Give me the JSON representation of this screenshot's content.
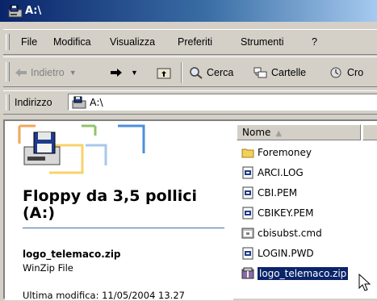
{
  "window": {
    "title": "A:\\"
  },
  "menubar": {
    "items": [
      {
        "label": "File"
      },
      {
        "label": "Modifica"
      },
      {
        "label": "Visualizza"
      },
      {
        "label": "Preferiti"
      },
      {
        "label": "Strumenti"
      },
      {
        "label": "?"
      }
    ]
  },
  "toolbar": {
    "back_label": "Indietro",
    "search_label": "Cerca",
    "folders_label": "Cartelle",
    "history_label": "Cro"
  },
  "address": {
    "label": "Indirizzo",
    "value": "A:\\"
  },
  "left_panel": {
    "drive_title": "Floppy da 3,5 pollici (A:)",
    "selected_file_name": "logo_telemaco.zip",
    "selected_file_type": "WinZip File",
    "selected_file_modified": "Ultima modifica: 11/05/2004 13.27"
  },
  "file_list": {
    "column_name": "Nome",
    "items": [
      {
        "name": "Foremoney",
        "icon": "folder-icon"
      },
      {
        "name": "ARCI.LOG",
        "icon": "text-file-icon"
      },
      {
        "name": "CBI.PEM",
        "icon": "text-file-icon"
      },
      {
        "name": "CBIKEY.PEM",
        "icon": "text-file-icon"
      },
      {
        "name": "cbisubst.cmd",
        "icon": "cmd-file-icon"
      },
      {
        "name": "LOGIN.PWD",
        "icon": "text-file-icon"
      },
      {
        "name": "logo_telemaco.zip",
        "icon": "zip-file-icon",
        "selected": true
      }
    ]
  },
  "colors": {
    "titlebar_start": "#0a246a",
    "titlebar_end": "#a6caf0",
    "selection": "#0a246a",
    "chrome": "#d4d0c8"
  }
}
